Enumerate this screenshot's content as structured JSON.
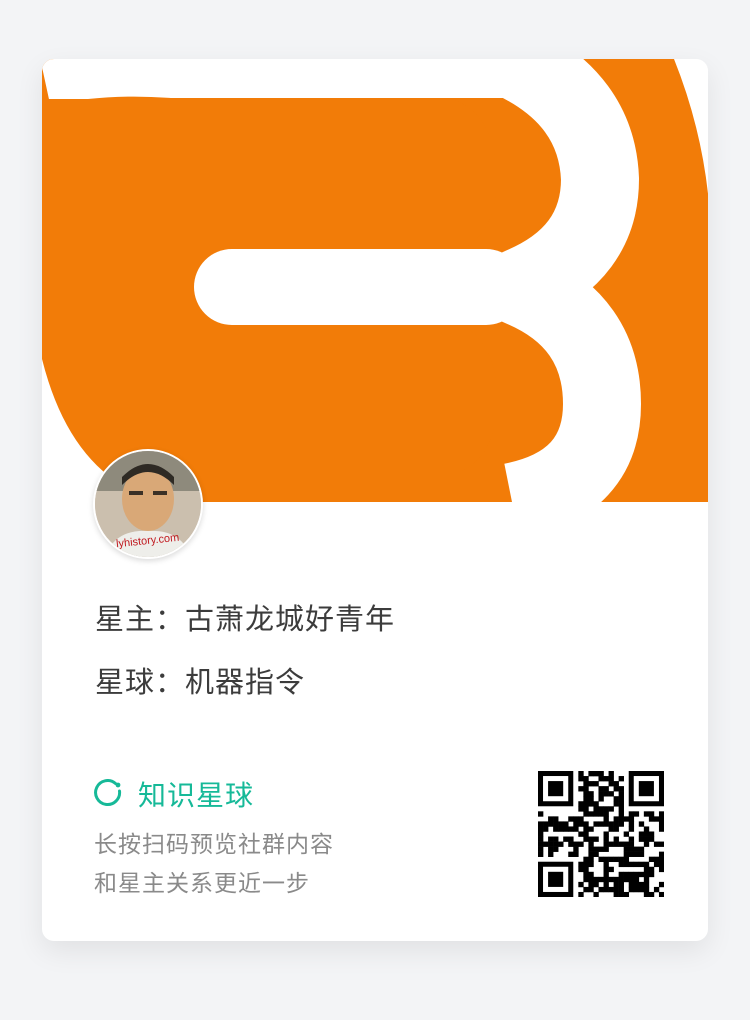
{
  "banner": {
    "logo_name": "orange-b-logo",
    "color": "#f27c08"
  },
  "avatar": {
    "watermark_text": "lyhistory.com"
  },
  "owner": {
    "label": "星主",
    "separator": "：",
    "name": "古萧龙城好青年"
  },
  "planet": {
    "label": "星球",
    "separator": "：",
    "name": "机器指令"
  },
  "brand": {
    "icon_name": "zsxq-ring-icon",
    "name": "知识星球",
    "color": "#16b998"
  },
  "hint": {
    "line1": "长按扫码预览社群内容",
    "line2": "和星主关系更近一步"
  },
  "qr": {
    "icon_name": "qr-code"
  }
}
